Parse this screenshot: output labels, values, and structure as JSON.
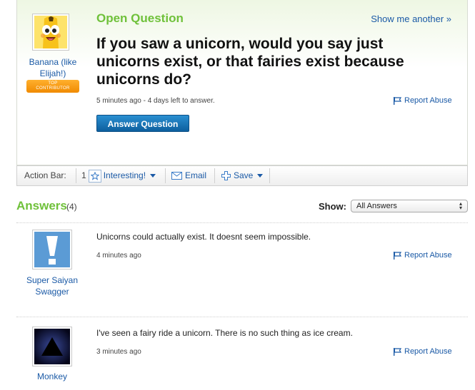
{
  "question": {
    "heading": "Open Question",
    "show_another": "Show me another »",
    "title": "If you saw a unicorn, would you say just unicorns exist, or that fairies exist because unicorns do?",
    "meta": "5 minutes ago - 4 days left to answer.",
    "report": "Report Abuse",
    "answer_button": "Answer Question",
    "asker": {
      "name": "Banana (like Elijah!)",
      "badge_line1": "TOP",
      "badge_line2": "CONTRIBUTOR"
    }
  },
  "action_bar": {
    "label": "Action Bar:",
    "interesting_count": "1",
    "interesting": "Interesting!",
    "email": "Email",
    "save": "Save"
  },
  "answers_section": {
    "title": "Answers",
    "count": "(4)",
    "show_label": "Show:",
    "filter_selected": "All Answers"
  },
  "answers": [
    {
      "user": "Super Saiyan Swagger",
      "text": "Unicorns could actually exist. It doesnt seem impossible.",
      "time": "4 minutes ago",
      "report": "Report Abuse"
    },
    {
      "user": "Monkey",
      "text": "I've seen a fairy ride a unicorn. There is no such thing as ice cream.",
      "time": "3 minutes ago",
      "report": "Report Abuse"
    }
  ],
  "colors": {
    "accent_green": "#6fc13a",
    "link_blue": "#1b5aa6",
    "button_blue": "#1a74b8",
    "badge_orange": "#f39a10"
  }
}
